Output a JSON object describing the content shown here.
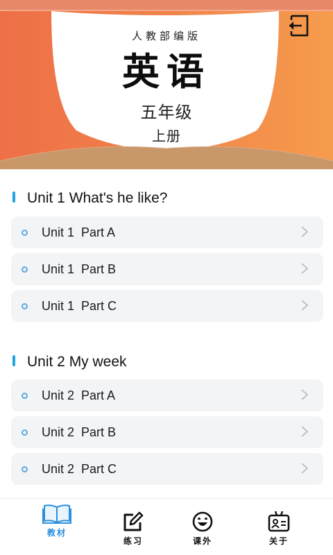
{
  "book": {
    "publisher": "人教部编版",
    "subject": "英语",
    "grade": "五年级",
    "volume": "上册"
  },
  "header": {
    "exit_icon": "exit-icon",
    "colors": {
      "cover_left": "#ee7a4b",
      "cover_right": "#f59a4c",
      "page_bottom": "#c9996a",
      "page_white": "#ffffff"
    }
  },
  "units": [
    {
      "title": "Unit 1 What's he like?",
      "lessons": [
        {
          "label": "Unit 1  Part A"
        },
        {
          "label": "Unit 1  Part B"
        },
        {
          "label": "Unit 1  Part C"
        }
      ]
    },
    {
      "title": "Unit 2 My week",
      "lessons": [
        {
          "label": "Unit 2  Part A"
        },
        {
          "label": "Unit 2  Part B"
        },
        {
          "label": "Unit 2  Part C"
        }
      ]
    }
  ],
  "bottom_nav": [
    {
      "label": "教材",
      "icon": "open-book-icon",
      "active": true
    },
    {
      "label": "练习",
      "icon": "edit-icon",
      "active": false
    },
    {
      "label": "课外",
      "icon": "smiley-icon",
      "active": false
    },
    {
      "label": "关于",
      "icon": "id-badge-icon",
      "active": false
    }
  ],
  "colors": {
    "accent": "#1fa2e6",
    "active_nav": "#2a8fdc",
    "row_background": "#f3f4f6"
  }
}
